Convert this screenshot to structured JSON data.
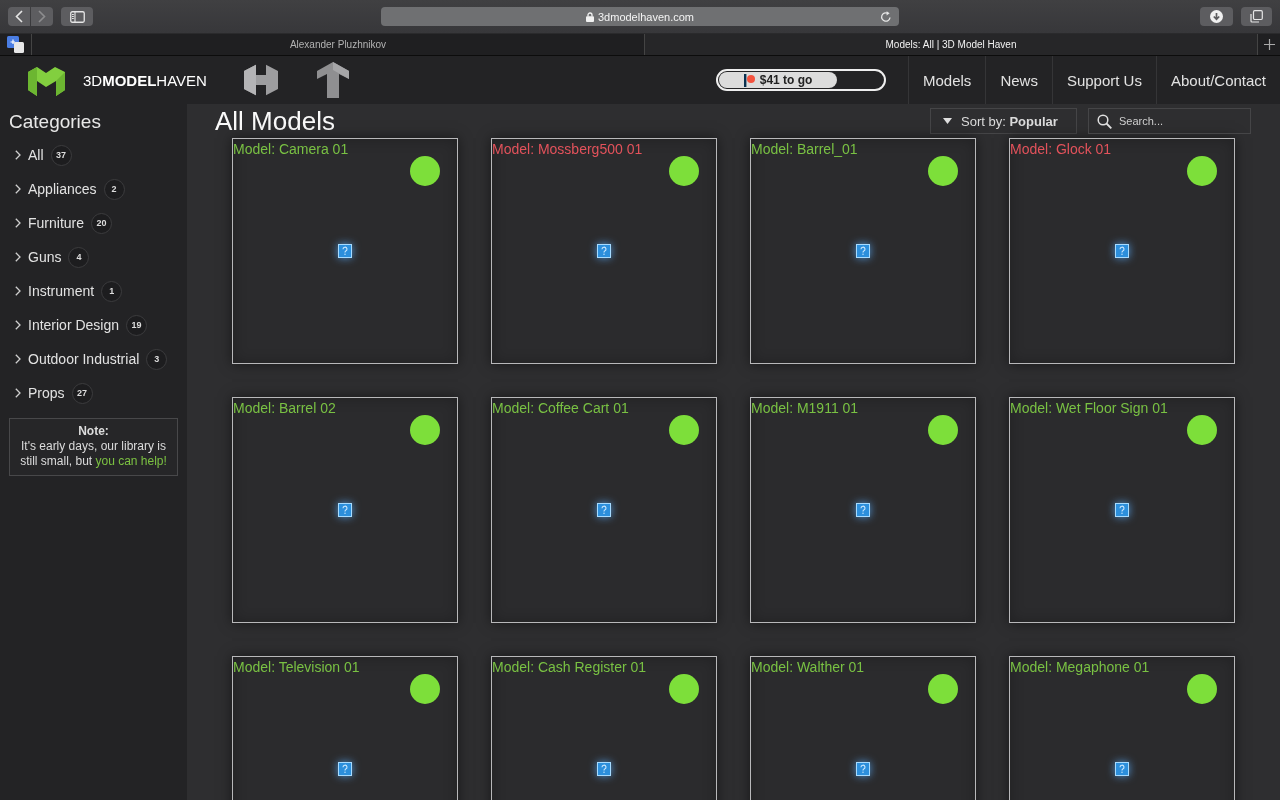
{
  "browser": {
    "url": "3dmodelhaven.com",
    "tabs": [
      {
        "title": "Alexander Pluzhnikov",
        "selected": false
      },
      {
        "title": "Models: All | 3D Model Haven",
        "selected": true
      }
    ]
  },
  "header": {
    "logo_text": "3D**MODEL**HAVEN",
    "goal": {
      "label": "$41 to go",
      "level": 0.72
    },
    "nav": [
      "Models",
      "News",
      "Support Us",
      "About/Contact"
    ]
  },
  "sidebar": {
    "title": "Categories",
    "categories": [
      {
        "name": "All",
        "count": "37"
      },
      {
        "name": "Appliances",
        "count": "2"
      },
      {
        "name": "Furniture",
        "count": "20"
      },
      {
        "name": "Guns",
        "count": "4"
      },
      {
        "name": "Instrument",
        "count": "1"
      },
      {
        "name": "Interior Design",
        "count": "19"
      },
      {
        "name": "Outdoor Industrial",
        "count": "3"
      },
      {
        "name": "Props",
        "count": "27"
      }
    ],
    "note": {
      "title": "Note:",
      "text": "It's early days, our library is still small, but",
      "link": "you can help!"
    }
  },
  "main": {
    "title": "All Models",
    "sort": "Sort by: **Popular**",
    "search": {
      "placeholder": "Search..."
    },
    "models": [
      {
        "title": "Model: Camera 01",
        "color": "#79c143"
      },
      {
        "title": "Model: Mossberg500 01",
        "color": "#e3525b"
      },
      {
        "title": "Model: Barrel_01",
        "color": "#79c143"
      },
      {
        "title": "Model: Glock 01",
        "color": "#e3525b"
      },
      {
        "title": "Model: Barrel 02",
        "color": "#79c143"
      },
      {
        "title": "Model: Coffee Cart 01",
        "color": "#79c143"
      },
      {
        "title": "Model: M1911 01",
        "color": "#79c143"
      },
      {
        "title": "Model: Wet Floor Sign 01",
        "color": "#79c143"
      },
      {
        "title": "Model: Television 01",
        "color": "#79c143"
      },
      {
        "title": "Model: Cash Register 01",
        "color": "#79c143"
      },
      {
        "title": "Model: Walther 01",
        "color": "#79c143"
      },
      {
        "title": "Model: Megaphone 01",
        "color": "#79c143"
      }
    ]
  }
}
